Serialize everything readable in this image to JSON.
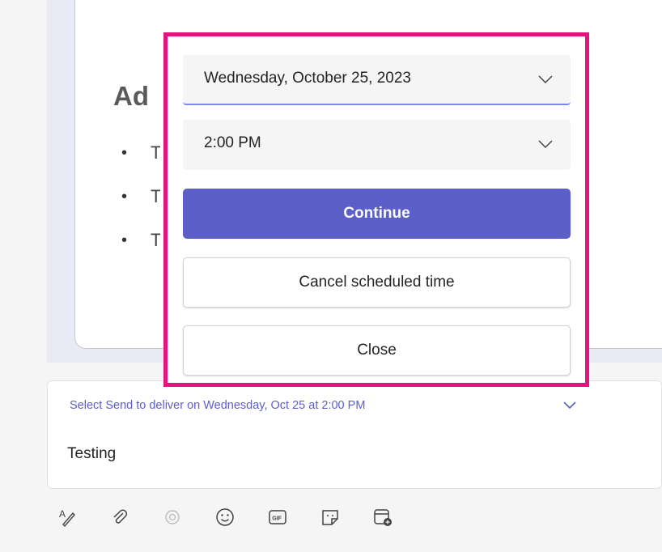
{
  "card": {
    "heading": "Ad",
    "bullets": [
      "T",
      "T",
      "T"
    ]
  },
  "schedule_popup": {
    "date_value": "Wednesday, October 25, 2023",
    "time_value": "2:00 PM",
    "continue_label": "Continue",
    "cancel_label": "Cancel scheduled time",
    "close_label": "Close",
    "highlight_color": "#e3147e",
    "accent_color": "#5b5fc7"
  },
  "compose": {
    "schedule_note": "Select Send to deliver on Wednesday, Oct 25 at 2:00 PM",
    "message_text": "Testing"
  },
  "toolbar": {
    "icons": [
      "format-icon",
      "attach-icon",
      "loop-icon",
      "emoji-icon",
      "gif-icon",
      "sticker-icon",
      "schedule-meeting-icon"
    ]
  }
}
